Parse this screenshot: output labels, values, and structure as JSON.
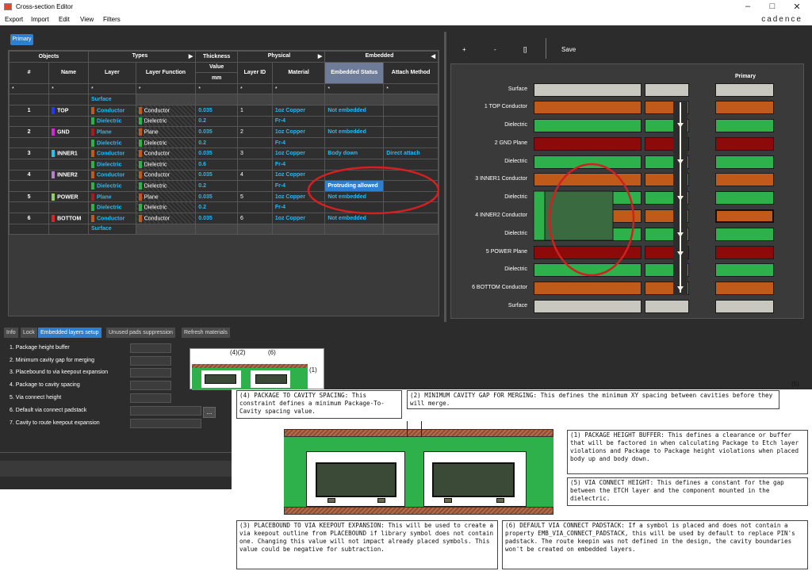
{
  "window": {
    "title": "Cross-section Editor"
  },
  "menu": [
    "Export",
    "Import",
    "Edit",
    "View",
    "Filters"
  ],
  "brand": "cadence",
  "primary_tab": "Primary",
  "table": {
    "group_headers": {
      "objects": "Objects",
      "types": "Types",
      "thickness": "Thickness",
      "physical": "Physical",
      "embedded": "Embedded"
    },
    "col_headers": {
      "num": "#",
      "name": "Name",
      "layer": "Layer",
      "layer_function": "Layer Function",
      "value": "Value",
      "mm": "mm",
      "layer_id": "Layer ID",
      "material": "Material",
      "embedded_status": "Embedded Status",
      "attach_method": "Attach Method"
    },
    "filter": "*",
    "rows": [
      {
        "num": "",
        "name": "",
        "layer": "Surface",
        "func": "",
        "thk": "",
        "id": "",
        "mat": "",
        "emb": "",
        "att": ""
      },
      {
        "num": "1",
        "name": "TOP",
        "chip": "#1f37ff",
        "layer": "Conductor",
        "func": "Conductor",
        "thk": "0.035",
        "id": "1",
        "mat": "1oz Copper",
        "emb": "Not embedded",
        "att": ""
      },
      {
        "num": "",
        "name": "",
        "layer": "Dielectric",
        "func": "Dielectric",
        "thk": "0.2",
        "id": "",
        "mat": "Fr-4",
        "emb": "",
        "att": ""
      },
      {
        "num": "2",
        "name": "GND",
        "chip": "#d02ad4",
        "layer": "Plane",
        "func": "Plane",
        "thk": "0.035",
        "id": "2",
        "mat": "1oz Copper",
        "emb": "Not embedded",
        "att": ""
      },
      {
        "num": "",
        "name": "",
        "layer": "Dielectric",
        "func": "Dielectric",
        "thk": "0.2",
        "id": "",
        "mat": "Fr-4",
        "emb": "",
        "att": ""
      },
      {
        "num": "3",
        "name": "INNER1",
        "chip": "#22c4f0",
        "layer": "Conductor",
        "func": "Conductor",
        "thk": "0.035",
        "id": "3",
        "mat": "1oz Copper",
        "emb": "Body down",
        "att": "Direct attach"
      },
      {
        "num": "",
        "name": "",
        "layer": "Dielectric",
        "func": "Dielectric",
        "thk": "0.6",
        "id": "",
        "mat": "Fr-4",
        "emb": "",
        "att": ""
      },
      {
        "num": "4",
        "name": "INNER2",
        "chip": "#b87fd0",
        "layer": "Conductor",
        "func": "Conductor",
        "thk": "0.035",
        "id": "4",
        "mat": "1oz Copper",
        "emb": "",
        "att": ""
      },
      {
        "num": "",
        "name": "",
        "layer": "Dielectric",
        "func": "Dielectric",
        "thk": "0.2",
        "id": "",
        "mat": "Fr-4",
        "emb": "Protruding allowed",
        "att": ""
      },
      {
        "num": "5",
        "name": "POWER",
        "chip": "#8fd062",
        "layer": "Plane",
        "func": "Plane",
        "thk": "0.035",
        "id": "5",
        "mat": "1oz Copper",
        "emb": "Not embedded",
        "att": ""
      },
      {
        "num": "",
        "name": "",
        "layer": "Dielectric",
        "func": "Dielectric",
        "thk": "0.2",
        "id": "",
        "mat": "Fr-4",
        "emb": "",
        "att": ""
      },
      {
        "num": "6",
        "name": "BOTTOM",
        "chip": "#e02020",
        "layer": "Conductor",
        "func": "Conductor",
        "thk": "0.035",
        "id": "6",
        "mat": "1oz Copper",
        "emb": "Not embedded",
        "att": ""
      },
      {
        "num": "",
        "name": "",
        "layer": "Surface",
        "func": "",
        "thk": "",
        "id": "",
        "mat": "",
        "emb": "",
        "att": ""
      }
    ]
  },
  "stackup": {
    "toolbar": {
      "plus": "+",
      "minus": "-",
      "brackets": "[]",
      "save": "Save"
    },
    "column_header": "Primary",
    "labels": [
      "Surface",
      "1   TOP Conductor",
      "Dielectric",
      "2   GND Plane",
      "Dielectric",
      "3   INNER1 Conductor",
      "Dielectric",
      "4   INNER2 Conductor",
      "Dielectric",
      "5   POWER Plane",
      "Dielectric",
      "6   BOTTOM Conductor",
      "Surface"
    ],
    "colors": {
      "surface": "#c8c8c0",
      "conductor": "#c05a1a",
      "dielectric": "#2eb04a",
      "plane": "#8c0a0a",
      "cavity": "#3a6a40",
      "circle": "#d02020"
    }
  },
  "bottom_tabs": [
    "Info",
    "Lock",
    "Embedded layers setup",
    "Unused pads suppression",
    "Refresh materials"
  ],
  "params": [
    "1. Package height buffer",
    "2. Minimum cavity gap for merging",
    "3. Placebound to via keepout expansion",
    "4. Package to cavity spacing",
    "5. Via connect height",
    "6. Default via connect padstack",
    "7. Cavity to route keepout expansion"
  ],
  "browse_button": "...",
  "figure_labels": {
    "a": "(4)(2)",
    "b": "(6)",
    "c": "(1)",
    "d": "(5)"
  },
  "annotations": {
    "a4": "(4) PACKAGE TO CAVITY SPACING: This constraint defines a minimum Package-To-Cavity spacing value.",
    "a2": "(2) MINIMUM CAVITY GAP FOR MERGING: This defines the minimum XY spacing between cavities before they will merge.",
    "a1": "(1) PACKAGE HEIGHT BUFFER: This defines a clearance or buffer that will be factored in when calculating Package to Etch layer violations and Package to Package height violations when placed body up and body down.",
    "a5": "(5) VIA CONNECT HEIGHT: This defines a constant for the gap between the ETCH layer and the component mounted in the dielectric.",
    "a3": "(3) PLACEBOUND TO VIA KEEPOUT EXPANSION: This will be used to create a via keepout outline from PLACEBOUND if library symbol does not contain one. Changing this value will not impact already placed symbols. This value could be negative for subtraction.",
    "a6": "(6) DEFAULT VIA CONNECT PADSTACK: If a symbol is placed and does not contain a property EMB_VIA_CONNECT_PADSTACK, this will be used by default to replace PIN's padstack. The route keepin was not defined in the design, the cavity boundaries won't be created on embedded layers."
  }
}
